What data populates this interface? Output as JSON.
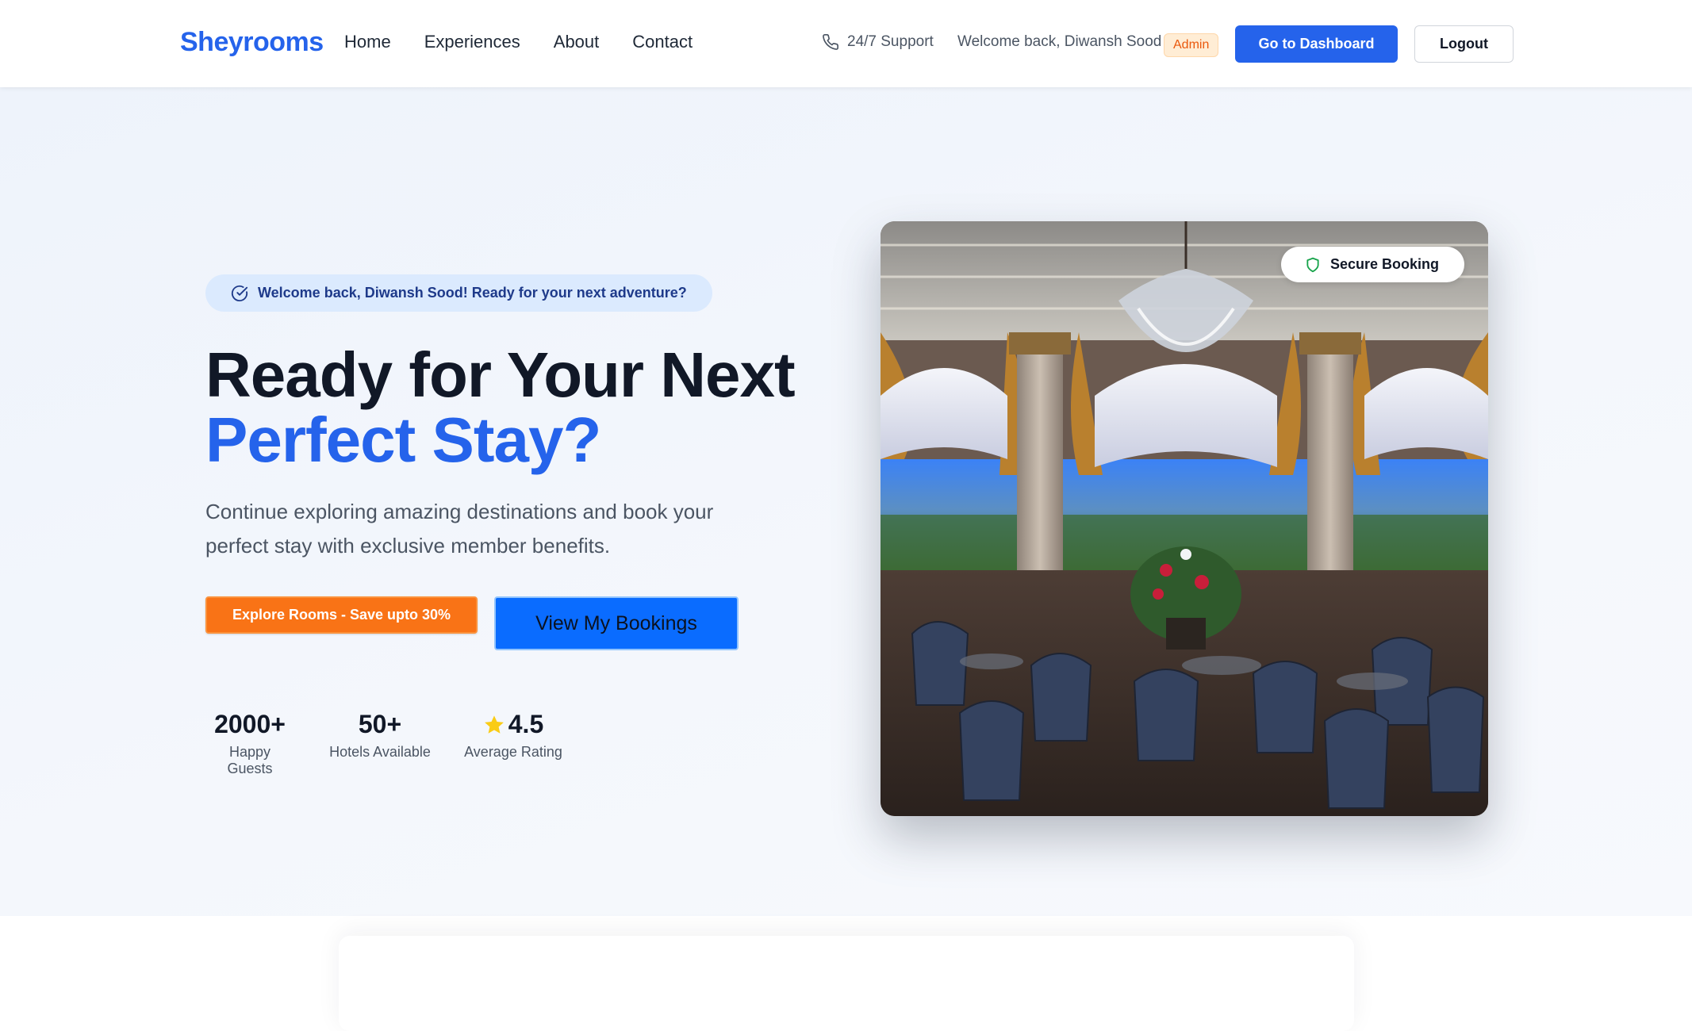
{
  "navbar": {
    "brand": "Sheyrooms",
    "links": [
      "Home",
      "Experiences",
      "About",
      "Contact"
    ],
    "support_label": "24/7 Support",
    "welcome_text": "Welcome back, Diwansh Sood",
    "role_badge": "Admin",
    "dashboard_button": "Go to Dashboard",
    "logout_button": "Logout"
  },
  "hero": {
    "welcome_pill": "Welcome back, Diwansh Sood! Ready for your next adventure?",
    "headline_line1": "Ready for Your Next",
    "headline_line2": "Perfect Stay?",
    "subtext": "Continue exploring amazing destinations and book your perfect stay with exclusive member benefits.",
    "explore_button": "Explore Rooms - Save upto 30%",
    "bookings_button": "View My Bookings",
    "stats": [
      {
        "value": "2000+",
        "label": "Happy Guests"
      },
      {
        "value": "50+",
        "label": "Hotels Available"
      },
      {
        "value": "4.5",
        "label": "Average Rating",
        "icon": "star-icon"
      }
    ],
    "image_badge": "Secure Booking"
  },
  "colors": {
    "brand": "#2563eb",
    "primary_button": "#2563eb",
    "explore_button": "#f97316",
    "bookings_button": "#0a6cff",
    "admin_badge": "#ea580c",
    "secure_icon": "#16a34a",
    "star": "#facc15"
  }
}
